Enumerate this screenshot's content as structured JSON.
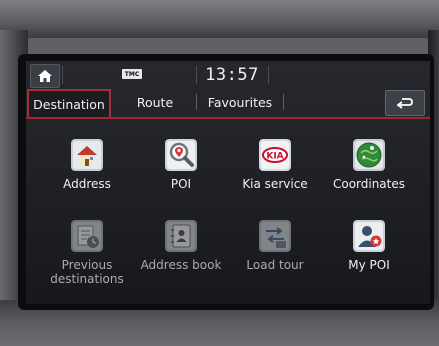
{
  "status_bar": {
    "tmc": "TMC",
    "time": "13:57"
  },
  "tabs": [
    {
      "label": "Destination",
      "active": true
    },
    {
      "label": "Route",
      "active": false
    },
    {
      "label": "Favourites",
      "active": false
    }
  ],
  "menu": [
    {
      "label": "Address",
      "icon": "address-house-icon",
      "enabled": true
    },
    {
      "label": "POI",
      "icon": "poi-magnifier-icon",
      "enabled": true
    },
    {
      "label": "Kia service",
      "icon": "kia-logo-icon",
      "enabled": true
    },
    {
      "label": "Coordinates",
      "icon": "globe-coordinates-icon",
      "enabled": true
    },
    {
      "label": "Previous destinations",
      "label_line1": "Previous",
      "label_line2": "destinations",
      "icon": "previous-destinations-icon",
      "enabled": false
    },
    {
      "label": "Address book",
      "icon": "address-book-icon",
      "enabled": false
    },
    {
      "label": "Load tour",
      "icon": "load-tour-icon",
      "enabled": false
    },
    {
      "label": "My POI",
      "icon": "my-poi-icon",
      "enabled": true
    }
  ],
  "kia_logo_text": "KIA",
  "colors": {
    "accent": "#a3303b",
    "screen_bg": "#1e2024",
    "text": "#f0f0f0",
    "dim_text": "#a9abaf"
  }
}
